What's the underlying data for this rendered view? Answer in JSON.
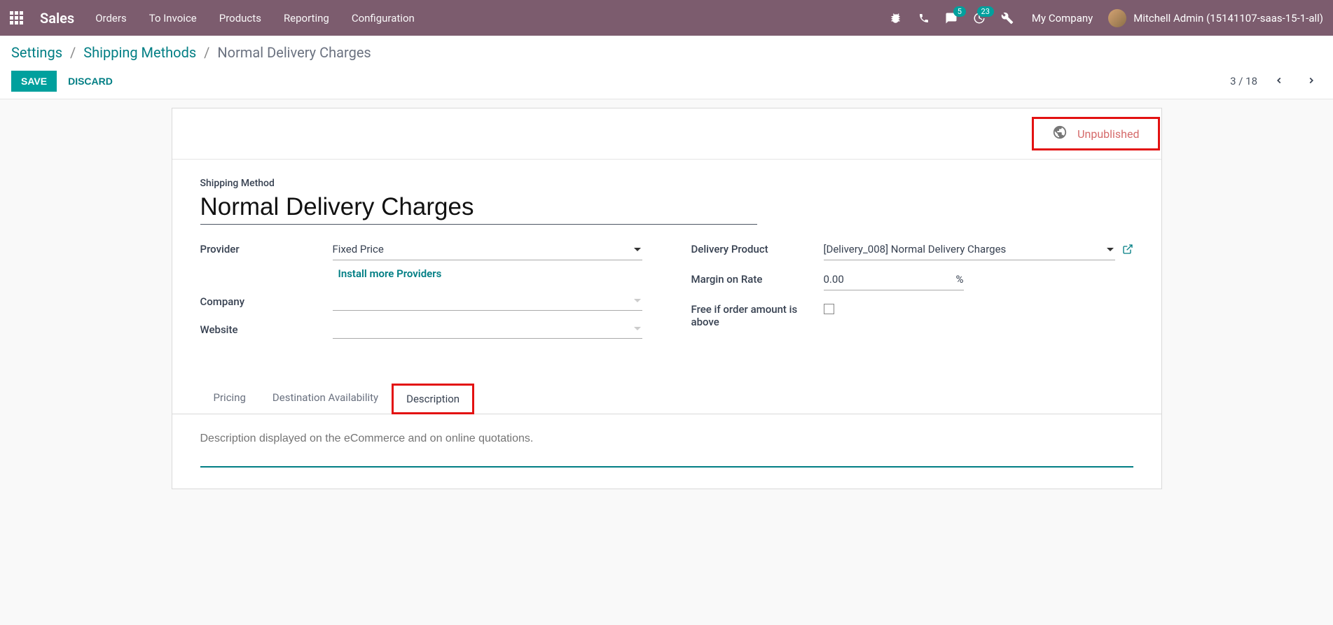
{
  "navbar": {
    "brand": "Sales",
    "menu": [
      "Orders",
      "To Invoice",
      "Products",
      "Reporting",
      "Configuration"
    ],
    "badges": {
      "chat": "5",
      "clock": "23"
    },
    "company": "My Company",
    "user": "Mitchell Admin (15141107-saas-15-1-all)"
  },
  "breadcrumb": {
    "root": "Settings",
    "parent": "Shipping Methods",
    "current": "Normal Delivery Charges"
  },
  "buttons": {
    "save": "SAVE",
    "discard": "DISCARD"
  },
  "pager": {
    "text": "3 / 18"
  },
  "publish": {
    "label": "Unpublished"
  },
  "form": {
    "title_label": "Shipping Method",
    "title_value": "Normal Delivery Charges",
    "provider_label": "Provider",
    "provider_value": "Fixed Price",
    "install_more": "Install more Providers",
    "company_label": "Company",
    "company_value": "",
    "website_label": "Website",
    "website_value": "",
    "delivery_product_label": "Delivery Product",
    "delivery_product_value": "[Delivery_008] Normal Delivery Charges",
    "margin_label": "Margin on Rate",
    "margin_value": "0.00",
    "margin_unit": "%",
    "free_label": "Free if order amount is above"
  },
  "tabs": {
    "items": [
      "Pricing",
      "Destination Availability",
      "Description"
    ],
    "active_index": 2,
    "description_placeholder": "Description displayed on the eCommerce and on online quotations."
  }
}
